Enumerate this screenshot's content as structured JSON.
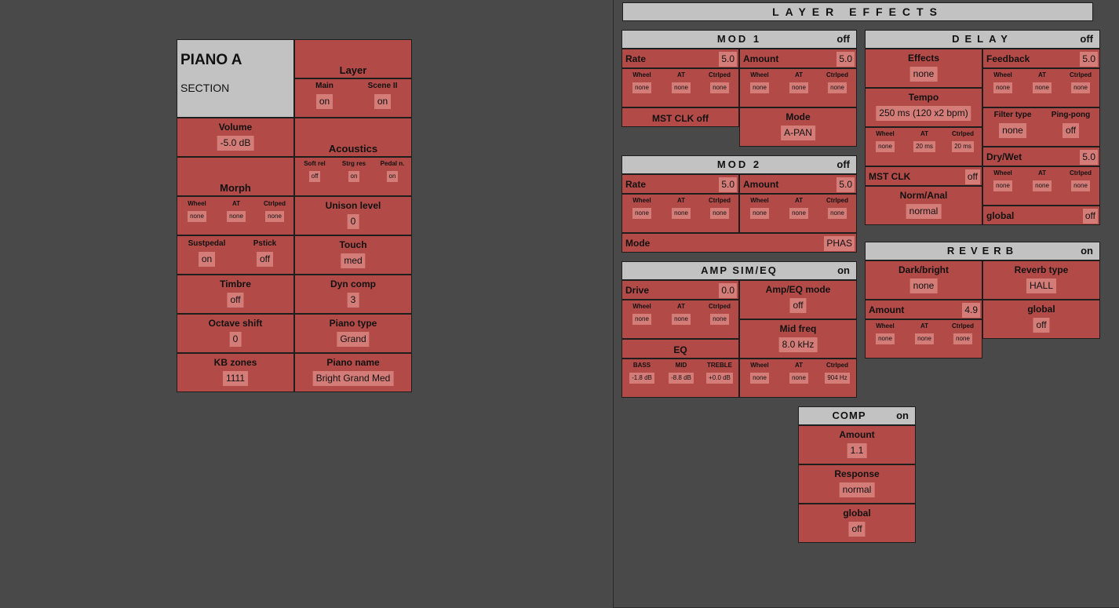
{
  "piano": {
    "name": "PIANO A",
    "section": "SECTION",
    "layer": {
      "title": "Layer",
      "main_label": "Main",
      "main_value": "on",
      "scene_label": "Scene II",
      "scene_value": "on"
    },
    "volume": {
      "title": "Volume",
      "value": "-5.0 dB"
    },
    "acoustics": {
      "title": "Acoustics",
      "items": [
        {
          "label": "Soft rel",
          "value": "off"
        },
        {
          "label": "Strg res",
          "value": "on"
        },
        {
          "label": "Pedal n.",
          "value": "on"
        }
      ]
    },
    "morph": {
      "title": "Morph",
      "items": [
        {
          "label": "Wheel",
          "value": "none"
        },
        {
          "label": "AT",
          "value": "none"
        },
        {
          "label": "Ctrlped",
          "value": "none"
        }
      ]
    },
    "unison": {
      "title": "Unison level",
      "value": "0"
    },
    "sustpedal": {
      "label": "Sustpedal",
      "value": "on"
    },
    "pstick": {
      "label": "Pstick",
      "value": "off"
    },
    "touch": {
      "title": "Touch",
      "value": "med"
    },
    "timbre": {
      "title": "Timbre",
      "value": "off"
    },
    "dyncomp": {
      "title": "Dyn comp",
      "value": "3"
    },
    "octave": {
      "title": "Octave shift",
      "value": "0"
    },
    "pianotype": {
      "title": "Piano type",
      "value": "Grand"
    },
    "kbzones": {
      "title": "KB zones",
      "value": "1111"
    },
    "pianoname": {
      "title": "Piano name",
      "value": "Bright Grand Med"
    }
  },
  "effects": {
    "title": "LAYER EFFECTS",
    "mod1": {
      "title": "MOD 1",
      "status": "off",
      "rate_label": "Rate",
      "rate_value": "5.0",
      "rate_mod": [
        {
          "label": "Wheel",
          "value": "none"
        },
        {
          "label": "AT",
          "value": "none"
        },
        {
          "label": "Ctrlped",
          "value": "none"
        }
      ],
      "amount_label": "Amount",
      "amount_value": "5.0",
      "amount_mod": [
        {
          "label": "Wheel",
          "value": "none"
        },
        {
          "label": "AT",
          "value": "none"
        },
        {
          "label": "Ctrlped",
          "value": "none"
        }
      ],
      "mstclk": "MST CLK off",
      "mode_title": "Mode",
      "mode_value": "A-PAN"
    },
    "mod2": {
      "title": "MOD 2",
      "status": "off",
      "rate_label": "Rate",
      "rate_value": "5.0",
      "rate_mod": [
        {
          "label": "Wheel",
          "value": "none"
        },
        {
          "label": "AT",
          "value": "none"
        },
        {
          "label": "Ctrlped",
          "value": "none"
        }
      ],
      "amount_label": "Amount",
      "amount_value": "5.0",
      "amount_mod": [
        {
          "label": "Wheel",
          "value": "none"
        },
        {
          "label": "AT",
          "value": "none"
        },
        {
          "label": "Ctrlped",
          "value": "none"
        }
      ],
      "mode_label": "Mode",
      "mode_value": "PHAS"
    },
    "ampsim": {
      "title": "AMP SIM/EQ",
      "status": "on",
      "drive_label": "Drive",
      "drive_value": "0.0",
      "drive_mod": [
        {
          "label": "Wheel",
          "value": "none"
        },
        {
          "label": "AT",
          "value": "none"
        },
        {
          "label": "Ctrlped",
          "value": "none"
        }
      ],
      "mode_title": "Amp/EQ mode",
      "mode_value": "off",
      "eq_title": "EQ",
      "eq": [
        {
          "label": "BASS",
          "value": "-1.8 dB"
        },
        {
          "label": "MID",
          "value": "-8.8 dB"
        },
        {
          "label": "TREBLE",
          "value": "+0.0 dB"
        }
      ],
      "midfreq_title": "Mid freq",
      "midfreq_value": "8.0 kHz",
      "mid_mod": [
        {
          "label": "Wheel",
          "value": "none"
        },
        {
          "label": "AT",
          "value": "none"
        },
        {
          "label": "Ctrlped",
          "value": "904 Hz"
        }
      ]
    },
    "delay": {
      "title": "DELAY",
      "status": "off",
      "effects_title": "Effects",
      "effects_value": "none",
      "feedback_label": "Feedback",
      "feedback_value": "5.0",
      "feedback_mod": [
        {
          "label": "Wheel",
          "value": "none"
        },
        {
          "label": "AT",
          "value": "none"
        },
        {
          "label": "Ctrlped",
          "value": "none"
        }
      ],
      "tempo_title": "Tempo",
      "tempo_value": "250 ms (120 x2 bpm)",
      "tempo_mod": [
        {
          "label": "Wheel",
          "value": "none"
        },
        {
          "label": "AT",
          "value": "20 ms"
        },
        {
          "label": "Ctrlped",
          "value": "20 ms"
        }
      ],
      "filter_label": "Filter type",
      "filter_value": "none",
      "pingpong_label": "Ping-pong",
      "pingpong_value": "off",
      "drywet_label": "Dry/Wet",
      "drywet_value": "5.0",
      "drywet_mod": [
        {
          "label": "Wheel",
          "value": "none"
        },
        {
          "label": "AT",
          "value": "none"
        },
        {
          "label": "Ctrlped",
          "value": "none"
        }
      ],
      "mstclk_label": "MST CLK",
      "mstclk_value": "off",
      "norm_title": "Norm/Anal",
      "norm_value": "normal",
      "global_label": "global",
      "global_value": "off"
    },
    "reverb": {
      "title": "REVERB",
      "status": "on",
      "dark_title": "Dark/bright",
      "dark_value": "none",
      "type_title": "Reverb type",
      "type_value": "HALL",
      "amount_label": "Amount",
      "amount_value": "4.9",
      "amount_mod": [
        {
          "label": "Wheel",
          "value": "none"
        },
        {
          "label": "AT",
          "value": "none"
        },
        {
          "label": "Ctrlped",
          "value": "none"
        }
      ],
      "global_title": "global",
      "global_value": "off"
    },
    "comp": {
      "title": "COMP",
      "status": "on",
      "amount_title": "Amount",
      "amount_value": "1.1",
      "response_title": "Response",
      "response_value": "normal",
      "global_title": "global",
      "global_value": "off"
    }
  }
}
